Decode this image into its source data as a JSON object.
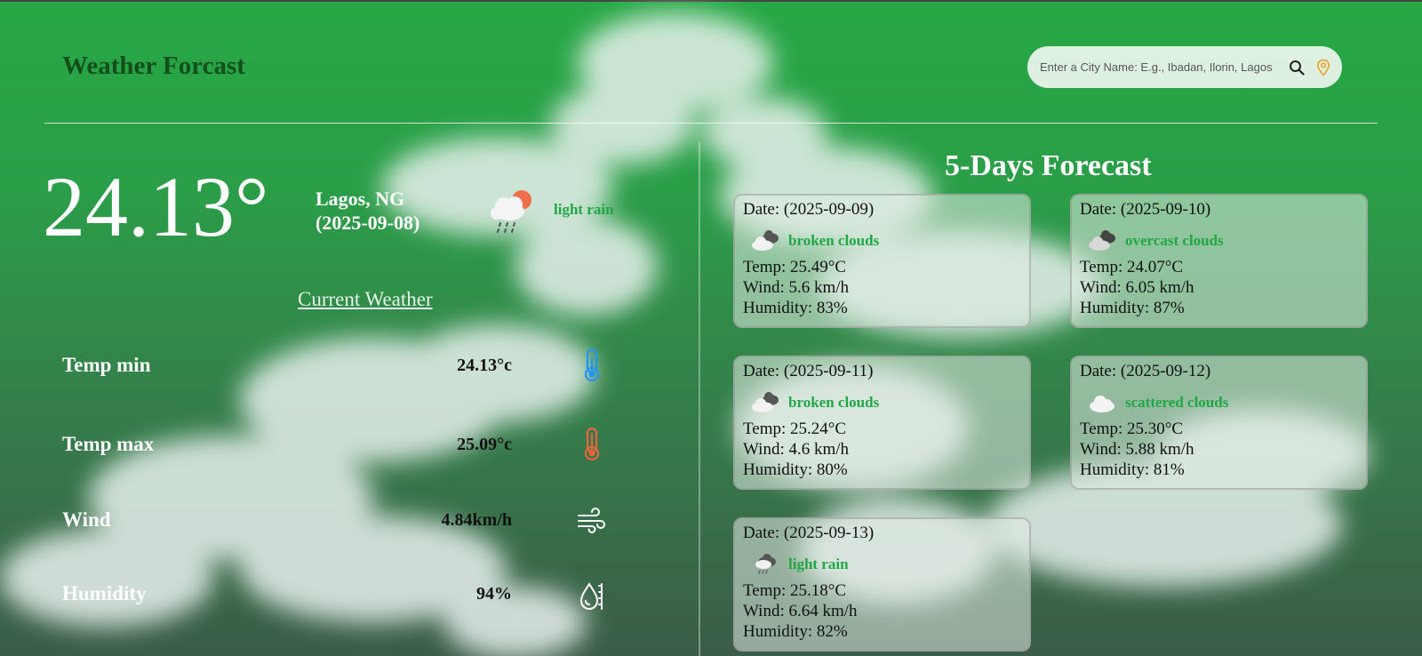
{
  "header": {
    "title": "Weather Forcast",
    "search_placeholder": "Enter a City Name: E.g., Ibadan, Ilorin, Lagos",
    "search_icon": "search-icon",
    "location_icon": "map-pin-icon"
  },
  "current": {
    "temperature": "24.13°",
    "location": "Lagos, NG",
    "date": "(2025-09-08)",
    "condition": "light rain",
    "condition_icon": "rain-sun-cloud-icon",
    "section_link": "Current Weather",
    "stats": [
      {
        "label": "Temp min",
        "value": "24.13°c",
        "icon": "thermometer-cold-icon"
      },
      {
        "label": "Temp max",
        "value": "25.09°c",
        "icon": "thermometer-hot-icon"
      },
      {
        "label": "Wind",
        "value": "4.84km/h",
        "icon": "wind-icon"
      },
      {
        "label": "Humidity",
        "value": "94%",
        "icon": "humidity-icon"
      }
    ]
  },
  "forecast": {
    "title": "5-Days Forecast",
    "days": [
      {
        "date": "Date: (2025-09-09)",
        "condition": "broken clouds",
        "icon": "broken-clouds-icon",
        "temp": "Temp: 25.49°C",
        "wind": "Wind: 5.6 km/h",
        "humidity": "Humidity: 83%"
      },
      {
        "date": "Date: (2025-09-10)",
        "condition": "overcast clouds",
        "icon": "overcast-clouds-icon",
        "temp": "Temp: 24.07°C",
        "wind": "Wind: 6.05 km/h",
        "humidity": "Humidity: 87%"
      },
      {
        "date": "Date: (2025-09-11)",
        "condition": "broken clouds",
        "icon": "broken-clouds-icon",
        "temp": "Temp: 25.24°C",
        "wind": "Wind: 4.6 km/h",
        "humidity": "Humidity: 80%"
      },
      {
        "date": "Date: (2025-09-12)",
        "condition": "scattered clouds",
        "icon": "scattered-clouds-icon",
        "temp": "Temp: 25.30°C",
        "wind": "Wind: 5.88 km/h",
        "humidity": "Humidity: 81%"
      },
      {
        "date": "Date: (2025-09-13)",
        "condition": "light rain",
        "icon": "rain-cloud-icon",
        "temp": "Temp: 25.18°C",
        "wind": "Wind: 6.64 km/h",
        "humidity": "Humidity: 82%"
      }
    ]
  },
  "colors": {
    "accent_green": "#1fa845",
    "title_dark_green": "#124f1b",
    "thermometer_cold": "#2196f3",
    "thermometer_hot": "#e8643c"
  }
}
